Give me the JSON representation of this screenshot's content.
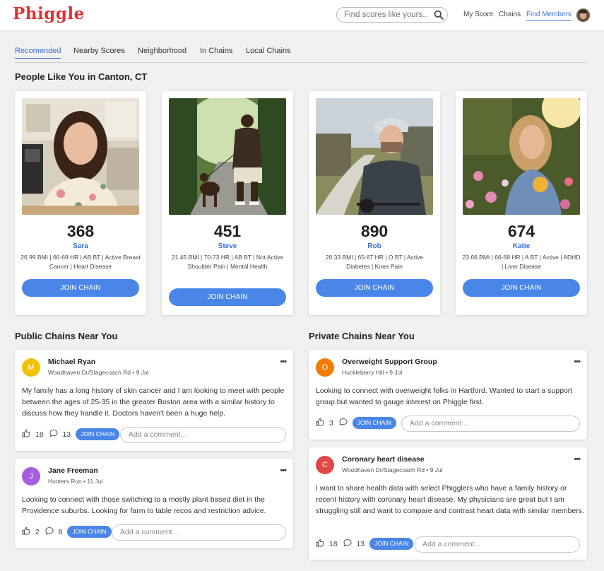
{
  "header": {
    "logo": "Phiggle",
    "search_placeholder": "Find scores like yours...",
    "nav": [
      "My Score",
      "Chains",
      "Find Members"
    ],
    "active_nav": "Find Members"
  },
  "tabs": [
    "Recomended",
    "Nearby Scores",
    "Neighborhood",
    "In Chains",
    "Local Chains"
  ],
  "active_tab": "Recomended",
  "people_section": {
    "title": "People Like You in Canton, CT",
    "people": [
      {
        "score": "368",
        "name": "Sara",
        "stats": "26.99 BMI | 66-69 HR | AB BT | Active Breast Cancer | Heart Disease",
        "button": "JOIN CHAIN"
      },
      {
        "score": "451",
        "name": "Steve",
        "stats": "21.45 BMI | 70-73 HR | AB BT | Not Active Shoulder Pain | Mental Health",
        "button": "JOIN CHAIN"
      },
      {
        "score": "890",
        "name": "Rob",
        "stats": "20.33 BMI | 65-67 HR | O BT | Active Diabetes | Knee Pain",
        "button": "JOIN CHAIN"
      },
      {
        "score": "674",
        "name": "Katie",
        "stats": "23.66 BMI | 66-68 HR | A BT | Active | ADHD | Liver Disease",
        "button": "JOIN CHAIN"
      }
    ]
  },
  "public_section": {
    "title": "Public Chains Near You",
    "posts": [
      {
        "initial": "M",
        "color": "#f2c200",
        "author": "Michael Ryan",
        "location": "Woodhaven Dr/Stagecoach Rd • 9 Jul",
        "text": "My family has a long history of skin cancer and I am looking to meet with people between the ages of 25-35 in the greater Boston area with a similar history to discuss how they handle it. Doctors haven't been a huge help.",
        "likes": "18",
        "comments": "13",
        "button": "JOIN CHAIN",
        "comment_placeholder": "Add a comment..."
      },
      {
        "initial": "J",
        "color": "#a55ee0",
        "author": "Jane Freeman",
        "location": "Hunters Run • 11 Jul",
        "text": "Looking to connect with those switching to a mostly plant based diet in the Providence suburbs. Looking for farm to table recos and restriction advice.",
        "likes": "2",
        "comments": "8",
        "button": "JOIN CHAIN",
        "comment_placeholder": "Add a comment..."
      }
    ]
  },
  "private_section": {
    "title": "Private Chains Near You",
    "posts": [
      {
        "initial": "O",
        "color": "#f07b00",
        "author": "Overweight Support Group",
        "location": "Huckleberry Hill • 9 Jul",
        "text": "Looking to connect with overweight folks in Hartford. Wanted to start a support group but wanted to gauge interest on Phiggle first.",
        "likes": "3",
        "comments": "",
        "button": "JOIN CHAIN",
        "comment_placeholder": "Add a comment..."
      },
      {
        "initial": "C",
        "color": "#e04848",
        "author": "Coronary heart disease",
        "location": "Woodhaven Dr/Stagecoach Rd • 9 Jul",
        "text": "I want to share health data with select Phigglers who have a family history or recent history with coronary heart disease. My physicians are great but I am struggling still and want to compare and contrast heart data with similar members.",
        "likes": "18",
        "comments": "13",
        "button": "JOIN CHAIN",
        "comment_placeholder": "Add a comment..."
      }
    ]
  }
}
